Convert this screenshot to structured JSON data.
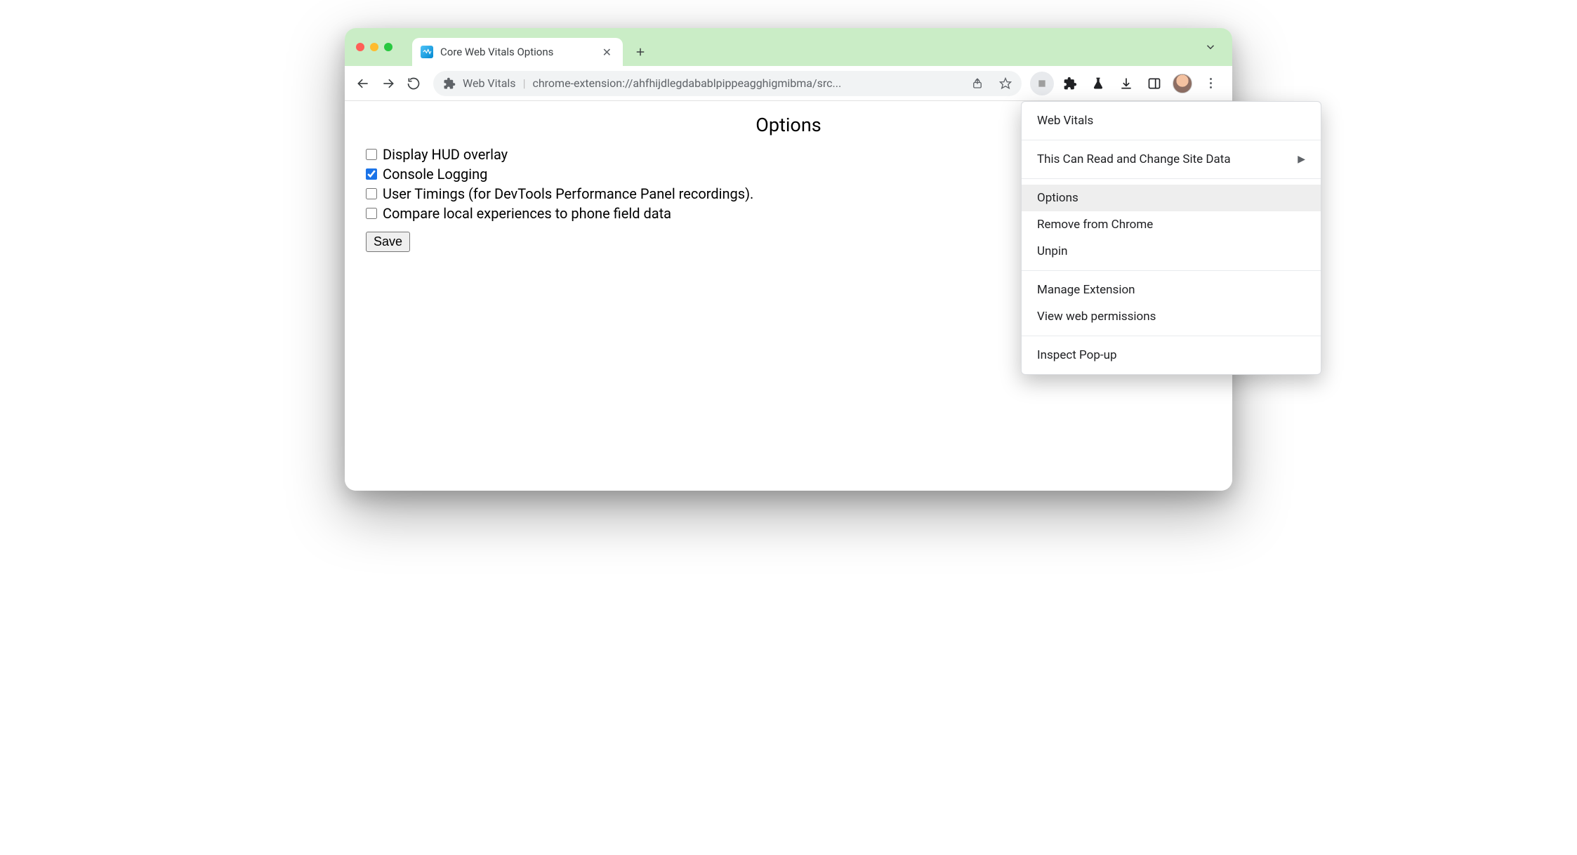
{
  "browser": {
    "tab_title": "Core Web Vitals Options",
    "omnibox_site": "Web Vitals",
    "omnibox_url": "chrome-extension://ahfhijdlegdabablpippeagghigmibma/src..."
  },
  "page": {
    "title": "Options",
    "options": {
      "hud": {
        "label": "Display HUD overlay",
        "checked": false
      },
      "console": {
        "label": "Console Logging",
        "checked": true
      },
      "timings": {
        "label": "User Timings (for DevTools Performance Panel recordings).",
        "checked": false
      },
      "compare": {
        "label": "Compare local experiences to phone field data",
        "checked": false
      }
    },
    "save_label": "Save"
  },
  "menu": {
    "header": "Web Vitals",
    "site_data": "This Can Read and Change Site Data",
    "options": "Options",
    "remove": "Remove from Chrome",
    "unpin": "Unpin",
    "manage": "Manage Extension",
    "permissions": "View web permissions",
    "inspect": "Inspect Pop-up"
  }
}
